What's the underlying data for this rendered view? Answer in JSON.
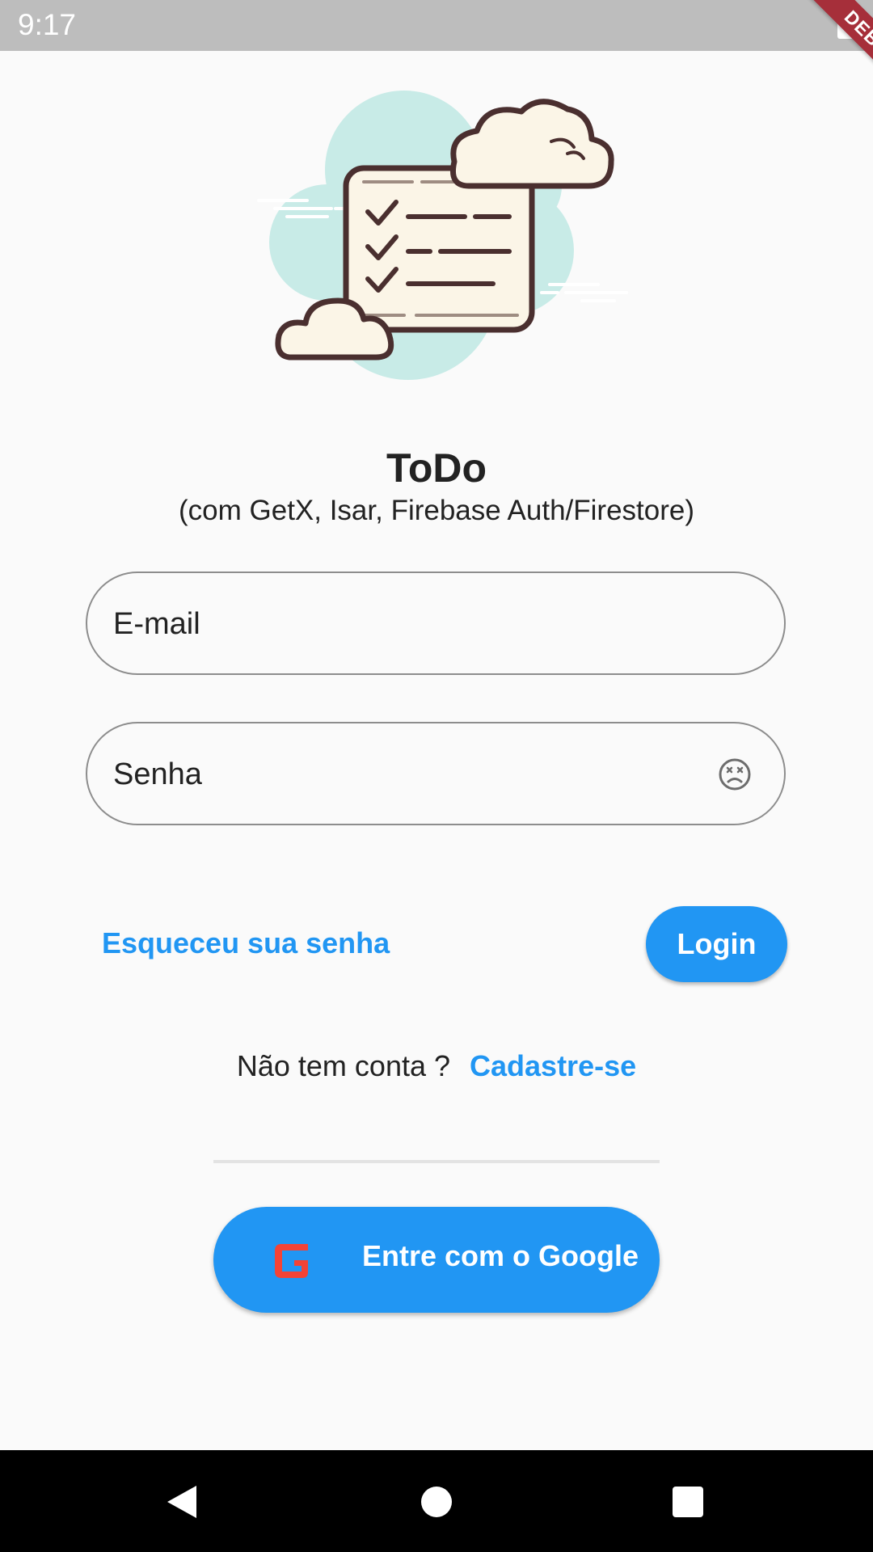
{
  "status_bar": {
    "time": "9:17"
  },
  "debug_banner": "DEBUG",
  "header": {
    "title": "ToDo",
    "subtitle": "(com GetX, Isar, Firebase Auth/Firestore)"
  },
  "form": {
    "email_placeholder": "E-mail",
    "password_placeholder": "Senha",
    "forgot_password": "Esqueceu sua senha",
    "login_button": "Login"
  },
  "signup": {
    "question": "Não tem conta ?",
    "link": "Cadastre-se"
  },
  "google_button": {
    "label": "Entre com o Google"
  },
  "icons": {
    "illustration": "todo-checklist-clouds-illustration",
    "visibility": "hidden-face-icon",
    "google": "google-g-icon",
    "nav": [
      "back-icon",
      "home-icon",
      "recents-icon"
    ]
  },
  "colors": {
    "primary": "#2196f3",
    "background": "#fafafa",
    "status_bar": "#bdbdbd",
    "debug": "#a62f3a",
    "google_g": "#f44336"
  }
}
